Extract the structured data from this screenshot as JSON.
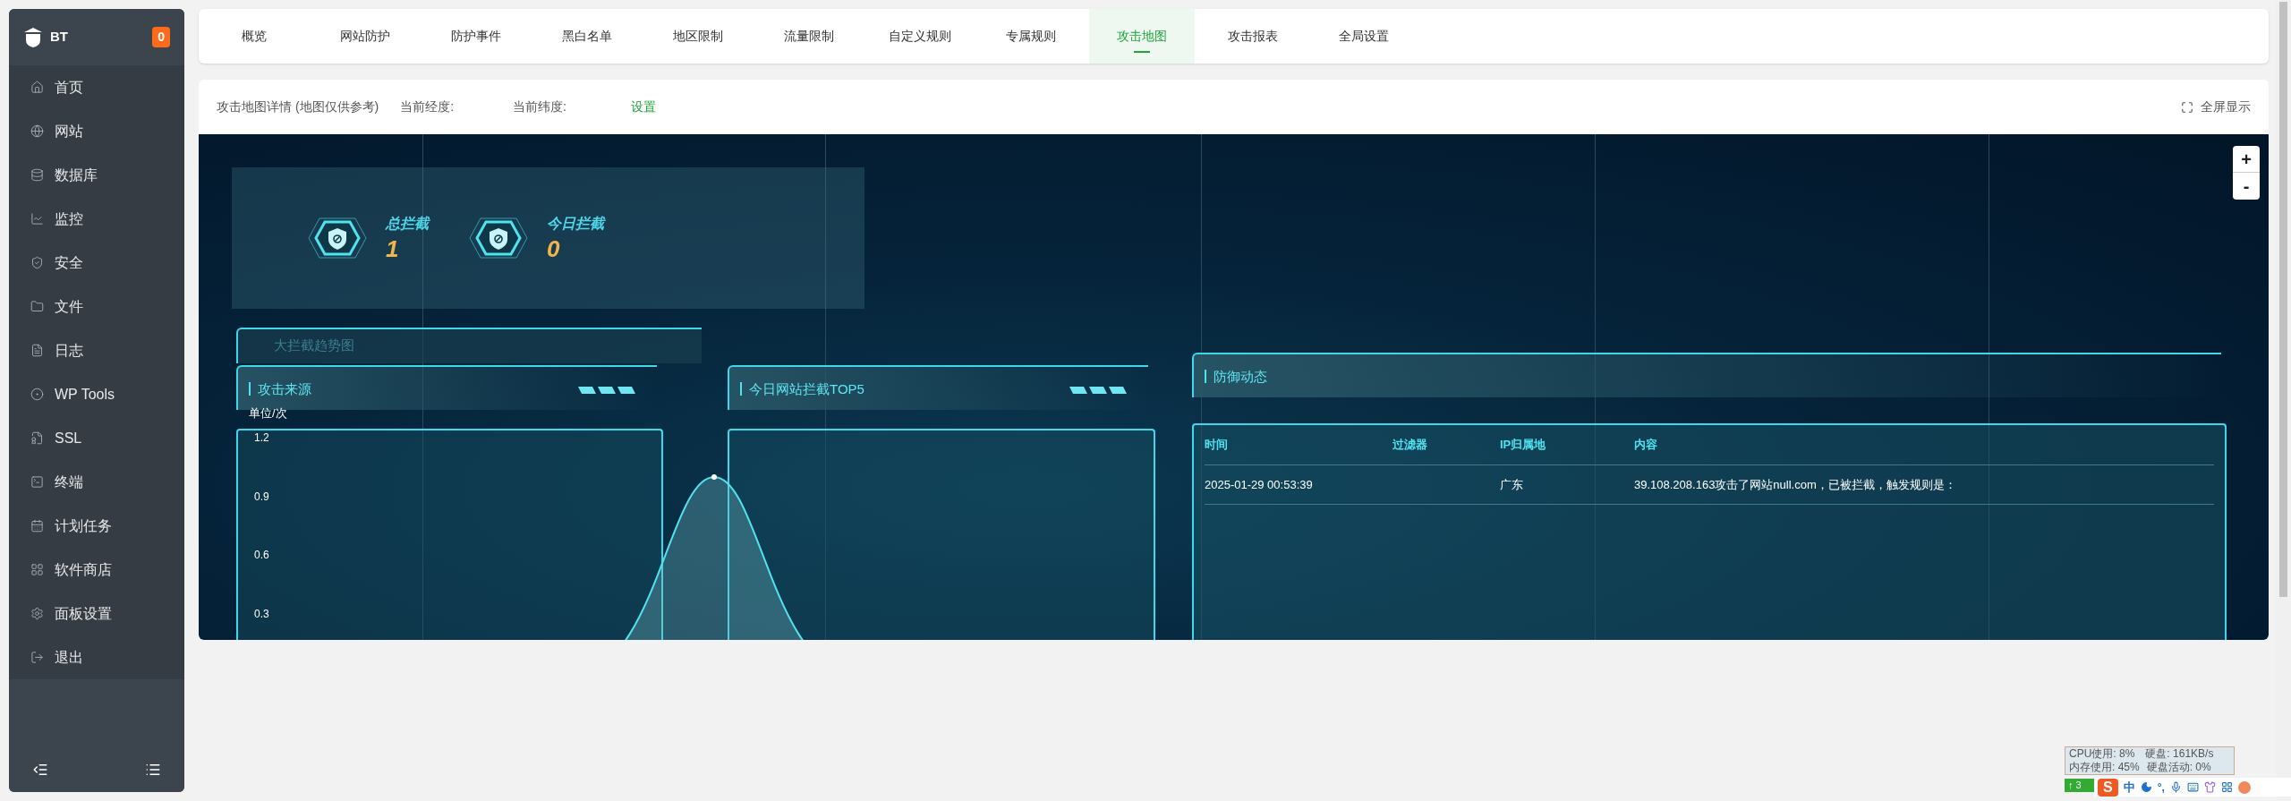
{
  "sidebar": {
    "logo": "BT",
    "badge": "0",
    "items": [
      {
        "label": "首页"
      },
      {
        "label": "网站"
      },
      {
        "label": "数据库"
      },
      {
        "label": "监控"
      },
      {
        "label": "安全"
      },
      {
        "label": "文件"
      },
      {
        "label": "日志"
      },
      {
        "label": "WP Tools"
      },
      {
        "label": "SSL"
      },
      {
        "label": "终端"
      },
      {
        "label": "计划任务"
      },
      {
        "label": "软件商店"
      },
      {
        "label": "面板设置"
      },
      {
        "label": "退出"
      }
    ]
  },
  "tabs": [
    {
      "label": "概览",
      "selected": false
    },
    {
      "label": "网站防护",
      "selected": false
    },
    {
      "label": "防护事件",
      "selected": false
    },
    {
      "label": "黑白名单",
      "selected": false
    },
    {
      "label": "地区限制",
      "selected": false
    },
    {
      "label": "流量限制",
      "selected": false
    },
    {
      "label": "自定义规则",
      "selected": false
    },
    {
      "label": "专属规则",
      "selected": false
    },
    {
      "label": "攻击地图",
      "selected": true
    },
    {
      "label": "攻击报表",
      "selected": false
    },
    {
      "label": "全局设置",
      "selected": false
    }
  ],
  "map_header": {
    "title": "攻击地图详情 (地图仅供参考)",
    "longitude_label": "当前经度:",
    "latitude_label": "当前纬度:",
    "settings_link": "设置",
    "fullscreen_button": "全屏显示"
  },
  "map": {
    "zoom_in": "+",
    "zoom_out": "-",
    "stats": [
      {
        "label": "总拦截",
        "value": "1"
      },
      {
        "label": "今日拦截",
        "value": "0"
      }
    ],
    "trend_panel": {
      "title": "大拦截趋势图"
    },
    "source_panel": {
      "title": "攻击来源",
      "unit": "单位/次",
      "y_axis_labels": [
        "1.2",
        "0.9",
        "0.6",
        "0.3"
      ]
    },
    "top5_panel": {
      "title": "今日网站拦截TOP5"
    },
    "defense_panel": {
      "title": "防御动态",
      "columns": [
        "时间",
        "过滤器",
        "IP归属地",
        "内容"
      ],
      "rows": [
        {
          "time": "2025-01-29 00:53:39",
          "location": "广东",
          "content": "39.108.208.163攻击了网站null.com，已被拦截，触发规则是："
        }
      ]
    }
  },
  "system_monitor": {
    "cpu": "CPU使用: 8%",
    "disk": "硬盘: 161KB/s",
    "memory": "内存使用: 45%",
    "disk_activity": "硬盘活动: 0%",
    "upload": "↑ 3"
  },
  "ime_toolbar": {
    "logo": "S",
    "mode": "中",
    "punctuation": "°,"
  }
}
